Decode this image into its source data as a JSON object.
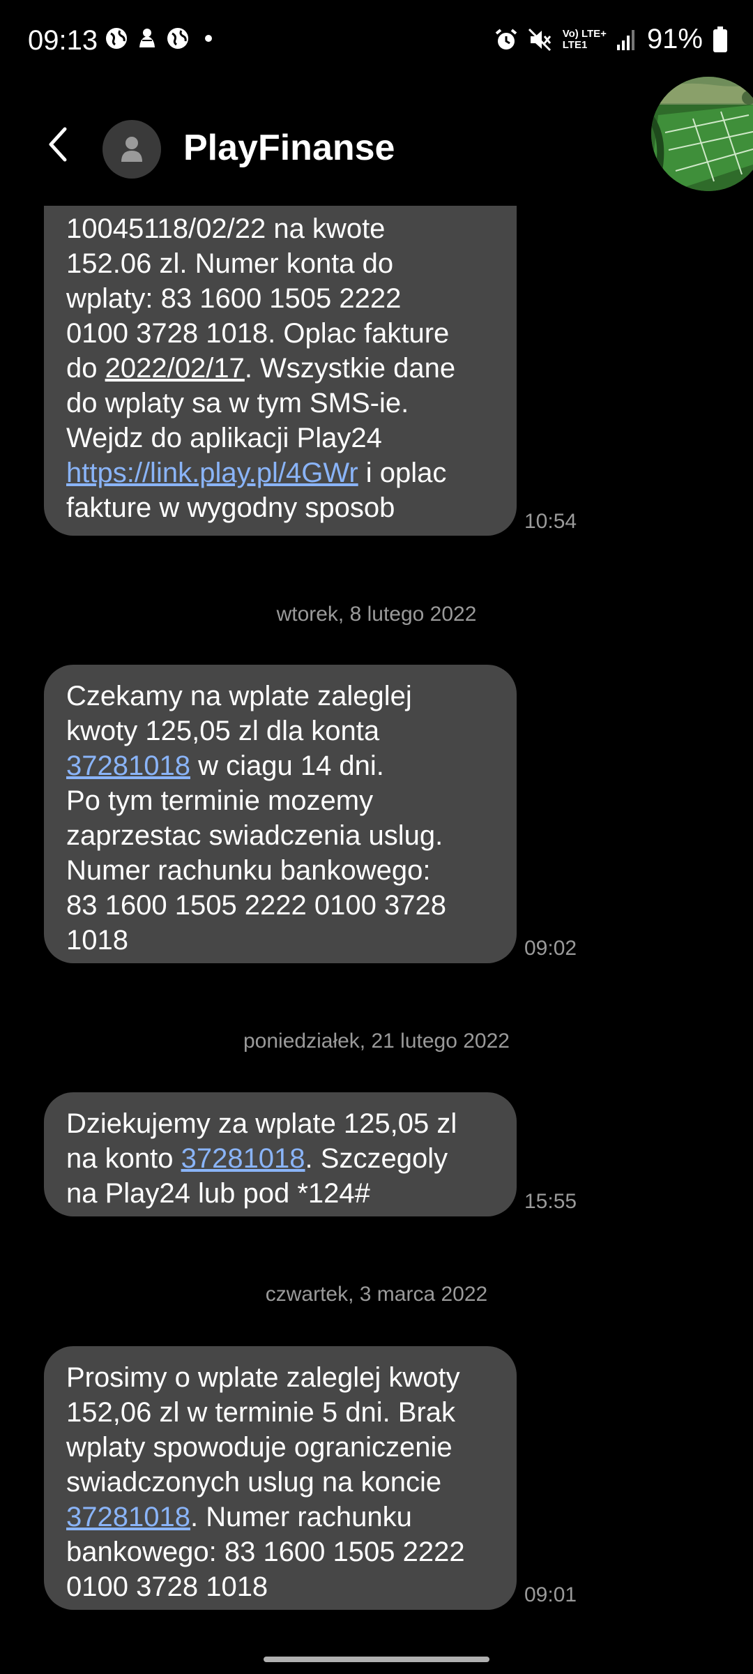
{
  "status_bar": {
    "time": "09:13",
    "lte_top": "Vo) LTE+",
    "lte_bottom": "LTE1",
    "battery": "91%"
  },
  "header": {
    "contact_name": "PlayFinanse"
  },
  "messages": [
    {
      "lines": [
        "10045118/02/22 na kwote",
        "152.06 zl. Numer konta do",
        "wplaty: 83 1600 1505 2222",
        "0100 3728 1018. Oplac fakture"
      ],
      "date_prefix": "do ",
      "date_link": "2022/02/17",
      "date_suffix": ". Wszystkie dane",
      "lines2": [
        "do wplaty sa w tym SMS-ie.",
        "Wejdz do aplikacji Play24"
      ],
      "url": "https://link.play.pl/4GWr",
      "url_suffix": " i oplac",
      "last_line": "fakture w wygodny sposob",
      "time": "10:54"
    },
    {
      "date_separator": "wtorek, 8 lutego 2022",
      "line1": "Czekamy na wplate zaleglej",
      "line2": "kwoty 125,05 zl dla konta",
      "account_link": "37281018",
      "after_link": " w ciagu 14 dni.",
      "lines": [
        "Po tym terminie mozemy",
        "zaprzestac swiadczenia uslug.",
        "Numer rachunku bankowego:",
        "83 1600 1505 2222 0100 3728",
        "1018"
      ],
      "time": "09:02"
    },
    {
      "date_separator": "poniedziałek, 21 lutego 2022",
      "line1": "Dziekujemy za wplate 125,05 zl",
      "before_link": "na konto ",
      "account_link": "37281018",
      "after_link": ". Szczegoly",
      "line3": "na Play24 lub pod *124#",
      "time": "15:55"
    },
    {
      "date_separator": "czwartek, 3 marca 2022",
      "lines": [
        "Prosimy o wplate zaleglej kwoty",
        "152,06 zl w terminie 5 dni. Brak",
        "wplaty spowoduje ograniczenie",
        "swiadczonych uslug na koncie"
      ],
      "account_link": "37281018",
      "after_link": ". Numer rachunku",
      "lines2": [
        "bankowego: 83 1600 1505 2222",
        "0100 3728 1018"
      ],
      "time": "09:01"
    }
  ],
  "colors": {
    "background": "#000000",
    "bubble": "#474747",
    "link": "#8ab4f8",
    "secondary_text": "#9a9a9a"
  }
}
